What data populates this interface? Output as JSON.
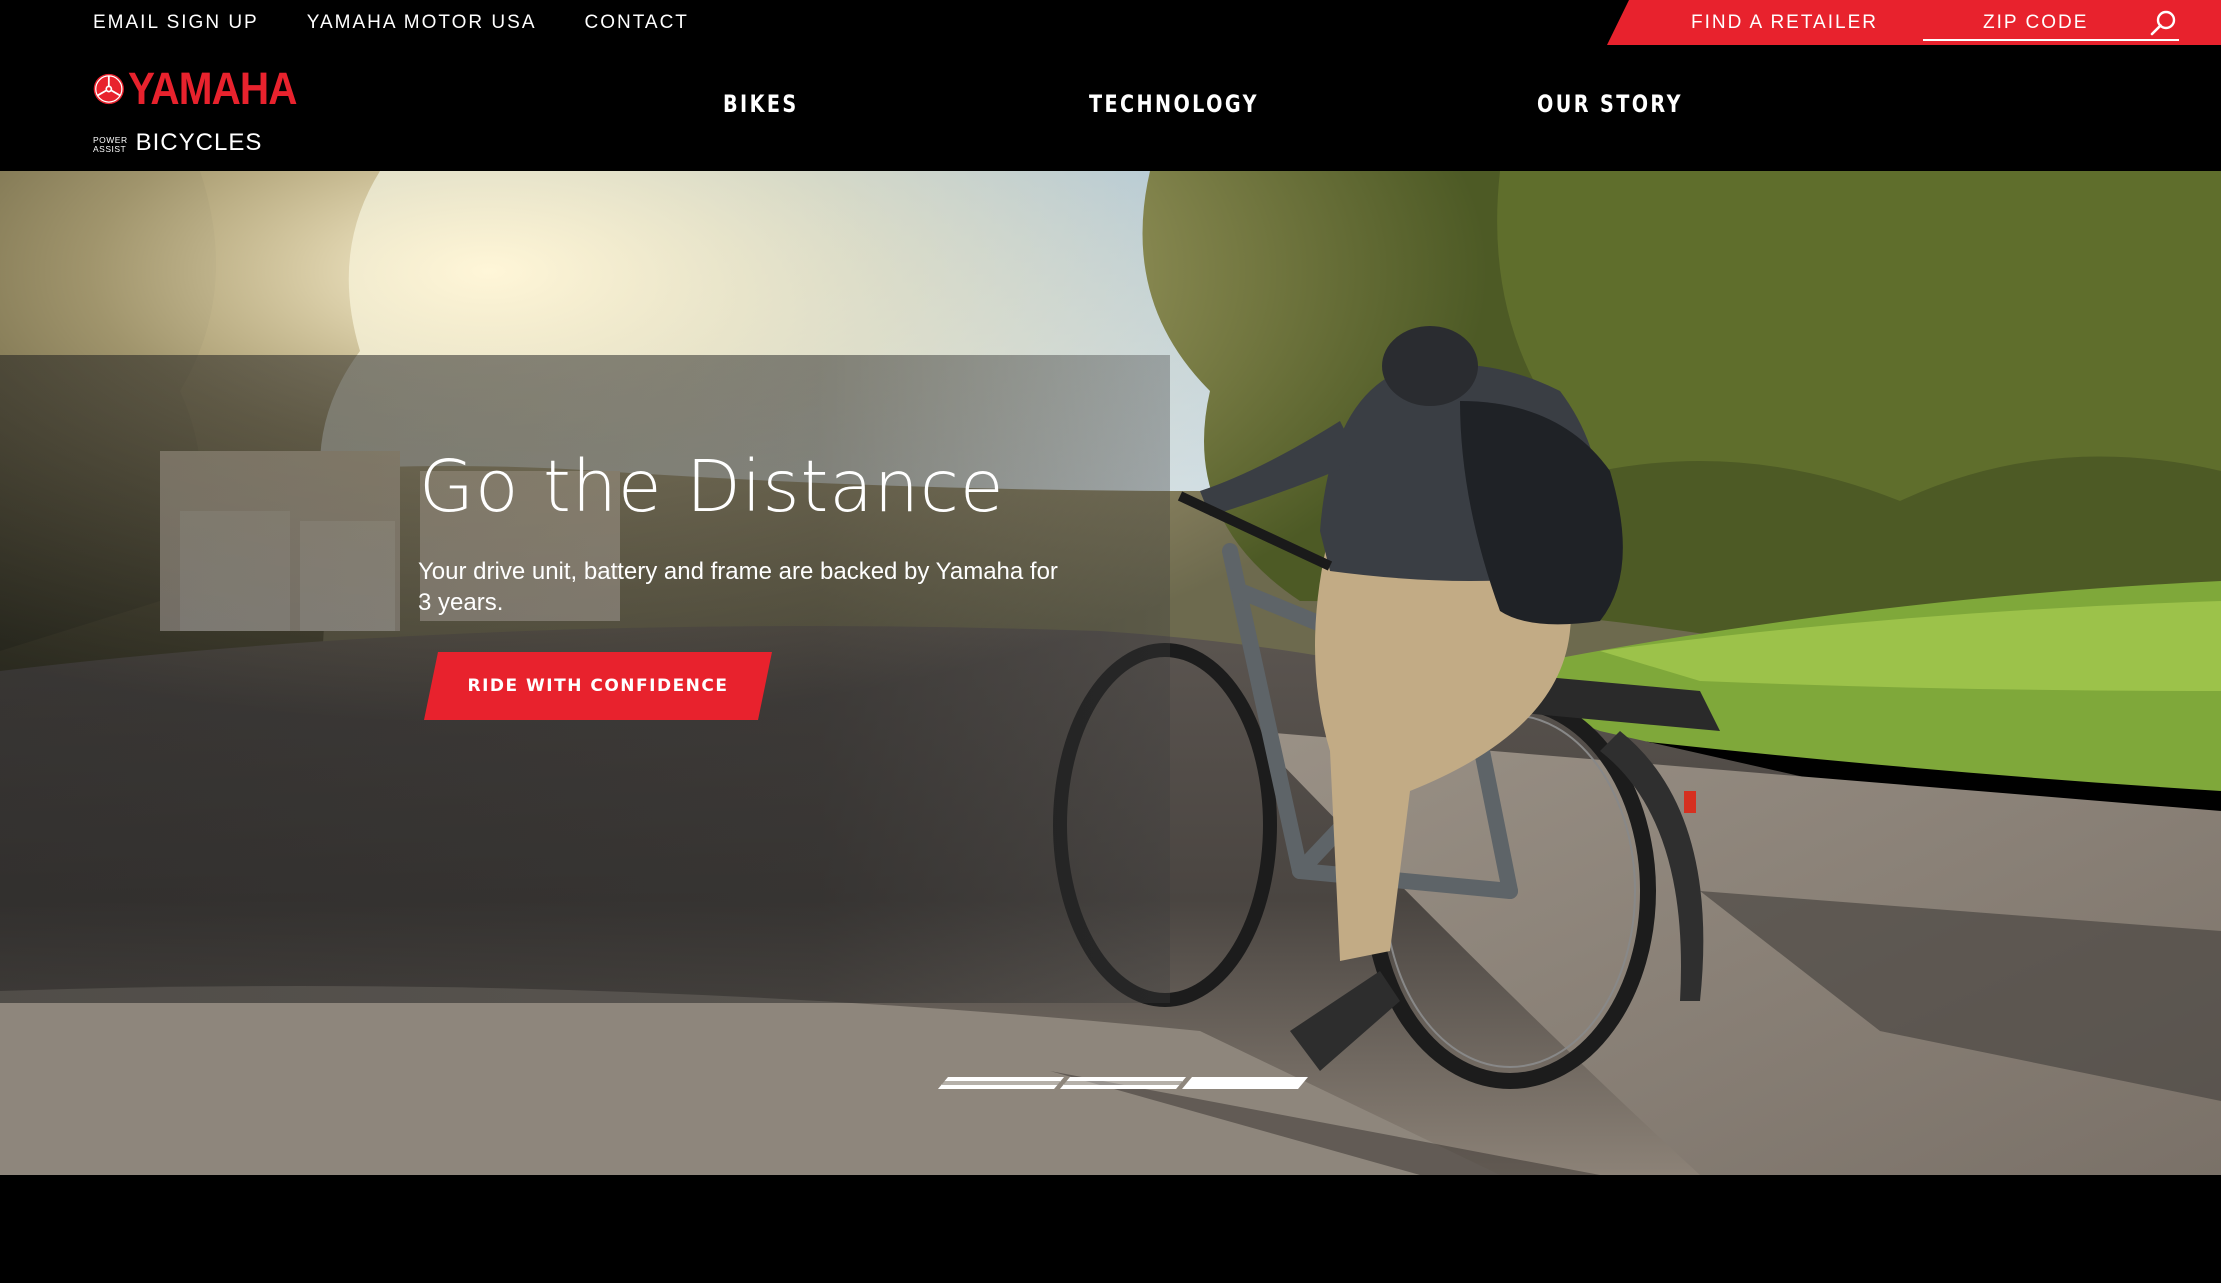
{
  "utility": {
    "links": [
      "EMAIL SIGN UP",
      "YAMAHA MOTOR USA",
      "CONTACT"
    ],
    "find_retailer": "FIND A RETAILER",
    "zip_placeholder": "ZIP CODE"
  },
  "brand": {
    "name": "YAMAHA",
    "small_line1": "POWER",
    "small_line2": "ASSIST",
    "bicycles": "BICYCLES"
  },
  "nav": {
    "items": [
      "BIKES",
      "TECHNOLOGY",
      "OUR STORY"
    ]
  },
  "hero": {
    "title": "Go the Distance",
    "subtitle": "Your drive unit, battery and frame are backed by Yamaha for 3 years.",
    "cta_label": "RIDE WITH CONFIDENCE",
    "slides": [
      {
        "active": false
      },
      {
        "active": false
      },
      {
        "active": true
      }
    ]
  },
  "colors": {
    "brand_red": "#e8222d",
    "background": "#000000"
  },
  "icons": [
    "search-icon",
    "tuning-fork-logo-icon"
  ]
}
